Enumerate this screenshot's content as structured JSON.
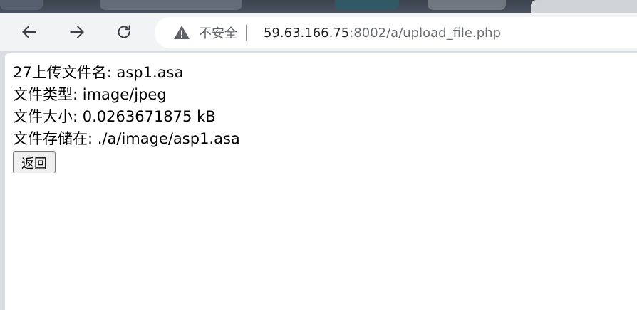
{
  "browser": {
    "security_label": "不安全",
    "url_host": "59.63.166.75",
    "url_rest": ":8002/a/upload_file.php"
  },
  "page": {
    "line_upload_name": "27上传文件名: asp1.asa",
    "line_type": "文件类型: image/jpeg",
    "line_size": "文件大小: 0.0263671875 kB",
    "line_stored": "文件存储在: ./a/image/asp1.asa",
    "back_button_label": "返回"
  }
}
